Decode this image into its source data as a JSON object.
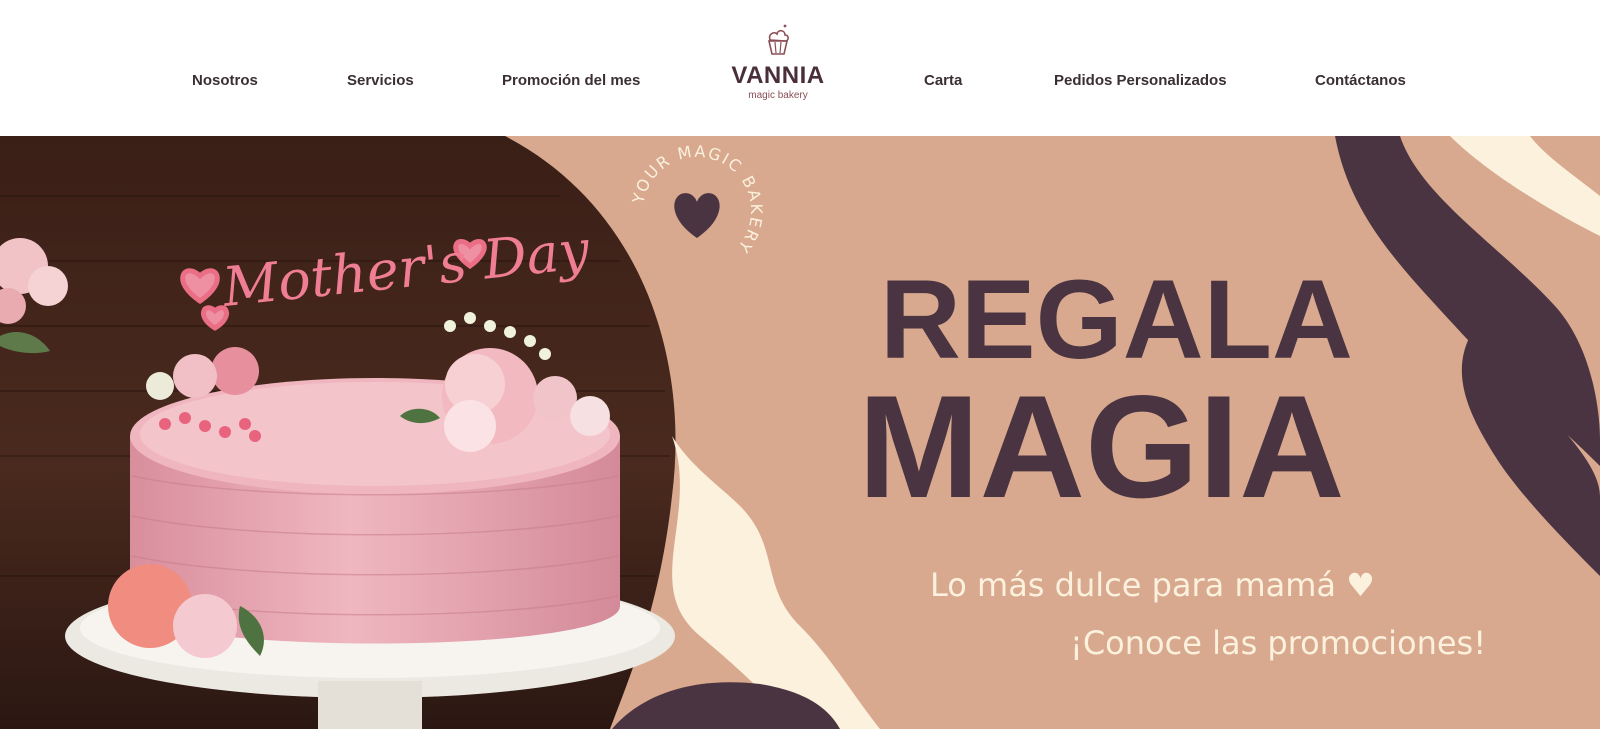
{
  "nav": {
    "left": [
      "Nosotros",
      "Servicios",
      "Promoción del mes"
    ],
    "right": [
      "Carta",
      "Pedidos Personalizados",
      "Contáctanos"
    ]
  },
  "logo": {
    "name": "VANNIA",
    "tagline": "magic bakery",
    "icon": "cupcake-icon"
  },
  "hero": {
    "badge_text": "YOUR MAGIC BAKERY",
    "badge_icon": "heart-icon",
    "cake_topper_text": "Mother's Day",
    "headline_line1": "REGALA",
    "headline_line2": "MAGIA",
    "subtitle_line1": "Lo más dulce para mamá ♥",
    "subtitle_line2": "¡Conoce las promociones!"
  },
  "colors": {
    "background_peach": "#d8a98e",
    "accent_plum": "#4a3441",
    "cream": "#fbf1dd",
    "text_dark": "#3b2f33",
    "cake_pink": "#e9a9b4"
  }
}
